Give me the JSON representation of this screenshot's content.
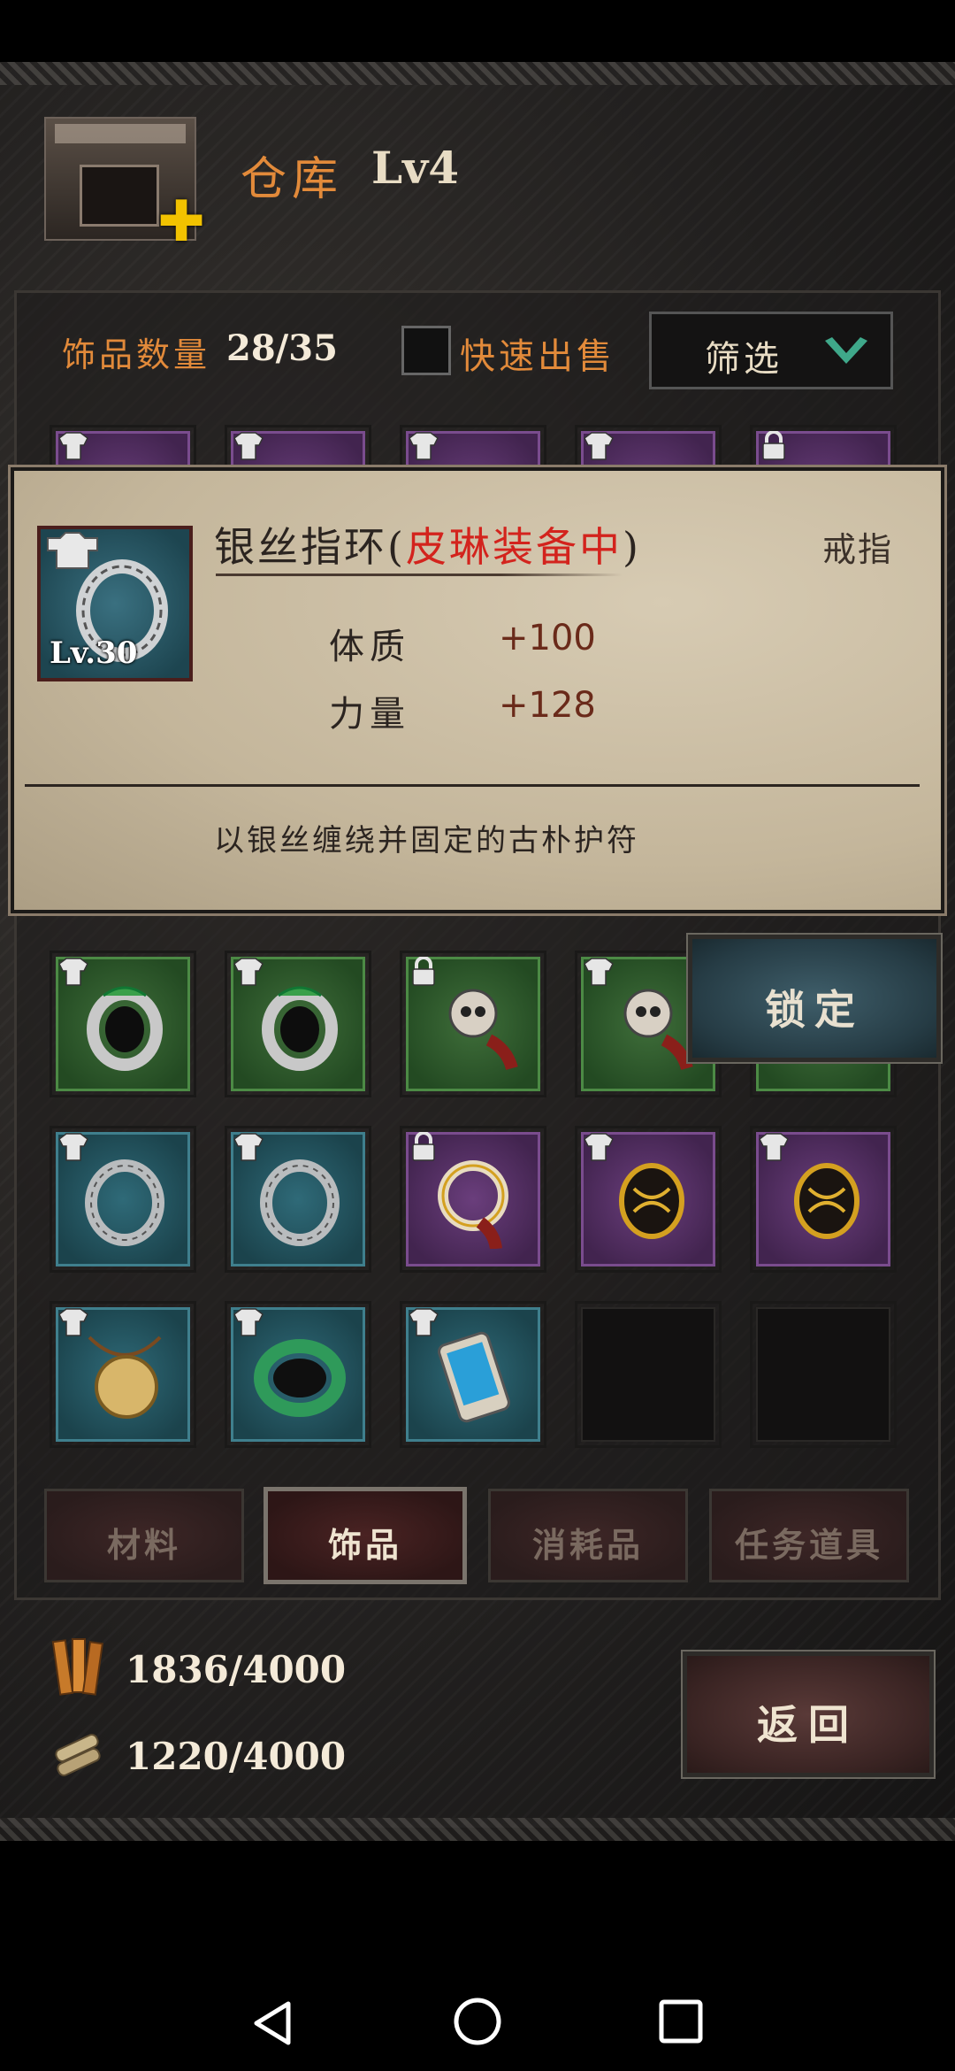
{
  "header": {
    "title": "仓库",
    "level": "Lv4"
  },
  "filters": {
    "count_label": "饰品数量",
    "count_value": "28/35",
    "quick_sell_label": "快速出售",
    "quick_sell_checked": false,
    "filter_label": "筛选"
  },
  "detail": {
    "name": "银丝指环(",
    "equipped_by": "皮琳装备中",
    "name_close": ")",
    "type": "戒指",
    "level": "Lv.30",
    "stats": [
      {
        "name": "体质",
        "value": "+100"
      },
      {
        "name": "力量",
        "value": "+128"
      }
    ],
    "description": "以银丝缠绕并固定的古朴护符"
  },
  "lock_button": {
    "label": "锁定"
  },
  "grid": [
    [
      {
        "rarity": "green",
        "item": "serpent-ring-icon",
        "tag": "equipped-shirt-icon"
      },
      {
        "rarity": "green",
        "item": "serpent-ring-icon",
        "tag": "equipped-shirt-icon"
      },
      {
        "rarity": "green",
        "item": "skull-charm-icon",
        "tag": "lock-icon"
      },
      {
        "rarity": "green",
        "item": "skull-charm-icon",
        "tag": "equipped-shirt-icon"
      },
      {
        "rarity": "green",
        "item": "hidden-item-icon",
        "tag": "none"
      }
    ],
    [
      {
        "rarity": "teal",
        "item": "silver-ring-icon",
        "tag": "equipped-shirt-icon"
      },
      {
        "rarity": "teal",
        "item": "silver-ring-icon",
        "tag": "equipped-shirt-icon"
      },
      {
        "rarity": "purple",
        "item": "gold-ring-icon",
        "tag": "lock-icon"
      },
      {
        "rarity": "purple",
        "item": "gold-amulet-icon",
        "tag": "equipped-shirt-icon"
      },
      {
        "rarity": "purple",
        "item": "gold-amulet-icon",
        "tag": "equipped-shirt-icon"
      }
    ],
    [
      {
        "rarity": "teal",
        "item": "coin-necklace-icon",
        "tag": "equipped-shirt-icon"
      },
      {
        "rarity": "teal",
        "item": "jade-bracelet-icon",
        "tag": "equipped-shirt-icon"
      },
      {
        "rarity": "teal",
        "item": "phone-icon",
        "tag": "equipped-shirt-icon"
      },
      {
        "rarity": "empty",
        "item": "",
        "tag": "none"
      },
      {
        "rarity": "empty",
        "item": "",
        "tag": "none"
      }
    ]
  ],
  "tabs": [
    {
      "label": "材料",
      "active": false
    },
    {
      "label": "饰品",
      "active": true
    },
    {
      "label": "消耗品",
      "active": false
    },
    {
      "label": "任务道具",
      "active": false
    }
  ],
  "resources": [
    {
      "icon": "wood-plank-icon",
      "value": "1836/4000"
    },
    {
      "icon": "scroll-bundle-icon",
      "value": "1220/4000"
    }
  ],
  "back_button": {
    "label": "返回"
  },
  "colors": {
    "accent": "#e28a3a",
    "equip_red": "#d3231d",
    "parchment": "#c4b69b"
  }
}
